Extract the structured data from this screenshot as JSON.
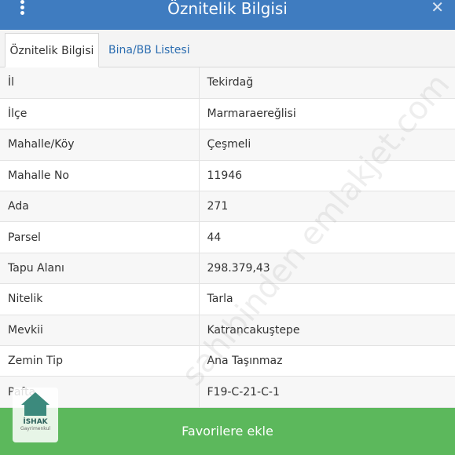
{
  "header": {
    "title": "Öznitelik Bilgisi"
  },
  "tabs": [
    {
      "label": "Öznitelik Bilgisi",
      "active": true
    },
    {
      "label": "Bina/BB Listesi",
      "active": false
    }
  ],
  "attributes": [
    {
      "key": "İl",
      "value": "Tekirdağ"
    },
    {
      "key": "İlçe",
      "value": "Marmaraereğlisi"
    },
    {
      "key": "Mahalle/Köy",
      "value": "Çeşmeli"
    },
    {
      "key": "Mahalle No",
      "value": "11946"
    },
    {
      "key": "Ada",
      "value": "271"
    },
    {
      "key": "Parsel",
      "value": "44"
    },
    {
      "key": "Tapu Alanı",
      "value": "298.379,43"
    },
    {
      "key": "Nitelik",
      "value": "Tarla"
    },
    {
      "key": "Mevkii",
      "value": "Katrancakuştepe"
    },
    {
      "key": "Zemin Tip",
      "value": "Ana Taşınmaz"
    },
    {
      "key": "Pafta",
      "value": "F19-C-21-C-1"
    }
  ],
  "favorite_button": {
    "label": "Favorilere ekle"
  },
  "watermark": {
    "text": "sahibinden emlakjet.com"
  },
  "logo": {
    "name": "İSHAK",
    "subtitle": "Gayrimenkul"
  },
  "colors": {
    "header": "#3f7cc0",
    "button": "#5cb85c",
    "tab_link": "#2a6cb0"
  }
}
